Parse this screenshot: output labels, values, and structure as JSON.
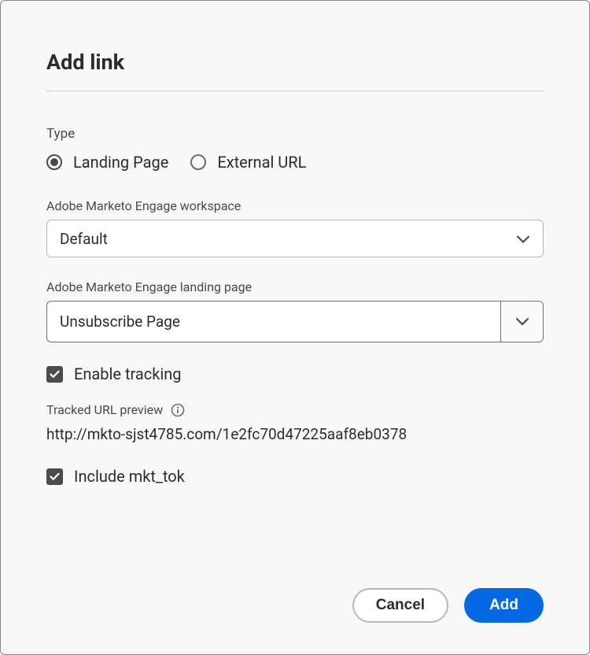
{
  "dialog": {
    "title": "Add link"
  },
  "type": {
    "label": "Type",
    "options": {
      "landing": "Landing Page",
      "external": "External URL"
    }
  },
  "workspace": {
    "label": "Adobe Marketo Engage workspace",
    "value": "Default"
  },
  "landingPage": {
    "label": "Adobe Marketo Engage landing page",
    "value": "Unsubscribe Page"
  },
  "tracking": {
    "enableLabel": "Enable tracking",
    "previewLabel": "Tracked URL preview",
    "url": "http://mkto-sjst4785.com/1e2fc70d47225aaf8eb0378",
    "includeTokLabel": "Include mkt_tok"
  },
  "footer": {
    "cancel": "Cancel",
    "add": "Add"
  }
}
